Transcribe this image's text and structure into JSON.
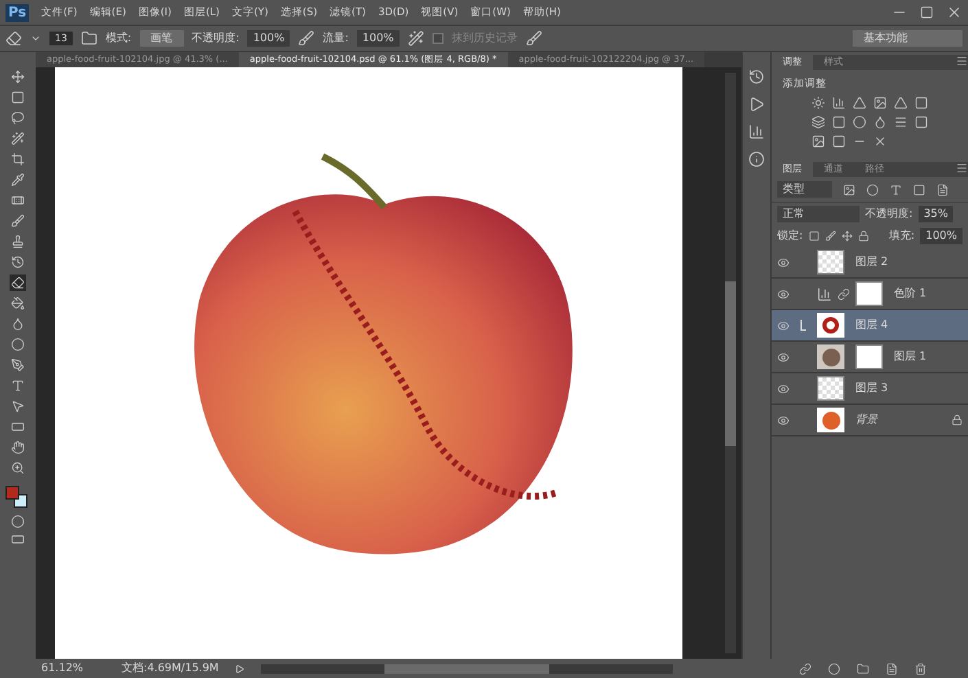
{
  "app": {
    "logo": "Ps"
  },
  "menu": [
    "文件(F)",
    "编辑(E)",
    "图像(I)",
    "图层(L)",
    "文字(Y)",
    "选择(S)",
    "滤镜(T)",
    "3D(D)",
    "视图(V)",
    "窗口(W)",
    "帮助(H)"
  ],
  "options_bar": {
    "brush_size": "13",
    "mode_label": "模式:",
    "mode_value": "画笔",
    "opacity_label": "不透明度:",
    "opacity_value": "100%",
    "flow_label": "流量:",
    "flow_value": "100%",
    "erase_history": {
      "label": "抹到历史记录",
      "checked": false
    },
    "workspace": "基本功能"
  },
  "tabs": [
    {
      "label": "apple-food-fruit-102104.jpg @ 41.3% (...",
      "selected": false
    },
    {
      "label": "apple-food-fruit-102104.psd @ 61.1% (图层 4, RGB/8) *",
      "selected": true
    },
    {
      "label": "apple-food-fruit-102122204.jpg @ 37...",
      "selected": false
    }
  ],
  "tools": [
    {
      "selected": false
    },
    {
      "selected": false
    },
    {
      "selected": false
    },
    {
      "selected": false
    },
    {
      "selected": false
    },
    {
      "selected": false
    },
    {
      "selected": false
    },
    {
      "selected": false
    },
    {
      "selected": false
    },
    {
      "selected": false
    },
    {
      "selected": true
    },
    {
      "selected": false
    },
    {
      "selected": false
    },
    {
      "selected": false
    },
    {
      "selected": false
    },
    {
      "selected": false
    },
    {
      "selected": false
    },
    {
      "selected": false
    },
    {
      "selected": false
    },
    {
      "selected": false
    }
  ],
  "adjustments_panel": {
    "tabs": [
      {
        "label": "调整",
        "selected": true
      },
      {
        "label": "样式",
        "selected": false
      }
    ],
    "title": "添加调整"
  },
  "layers_panel": {
    "tabs": [
      {
        "label": "图层",
        "selected": true
      },
      {
        "label": "通道",
        "selected": false
      },
      {
        "label": "路径",
        "selected": false
      }
    ],
    "filter": "类型",
    "blend_mode": "正常",
    "opacity_label": "不透明度:",
    "opacity_value": "35%",
    "lock_label": "锁定:",
    "fill_label": "填充:",
    "fill_value": "100%",
    "layers": [
      {
        "name": "图层 2",
        "kind": "pixel",
        "selected": false,
        "clipped": false
      },
      {
        "name": "色阶 1",
        "kind": "adjustment",
        "selected": false,
        "clipped": false
      },
      {
        "name": "图层 4",
        "kind": "pixel_red",
        "selected": true,
        "clipped": true
      },
      {
        "name": "图层 1",
        "kind": "masked",
        "selected": false,
        "clipped": false
      },
      {
        "name": "图层 3",
        "kind": "pixel",
        "selected": false,
        "clipped": false
      },
      {
        "name": "背景",
        "kind": "background",
        "selected": false,
        "clipped": false
      }
    ]
  },
  "status_bar": {
    "zoom": "61.12%",
    "document": "文档:4.69M/15.9M"
  }
}
